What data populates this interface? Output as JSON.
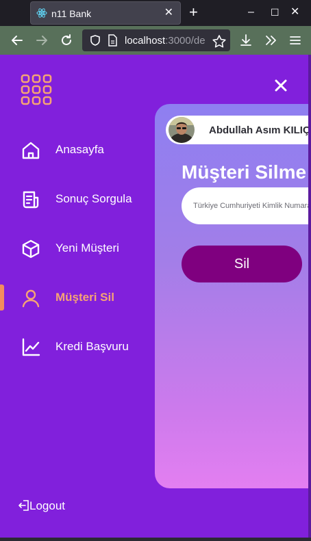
{
  "browser": {
    "tab_title": "n11 Bank",
    "tab_close": "✕",
    "new_tab": "+",
    "url_host": "localhost",
    "url_rest": ":3000/de",
    "window_controls": {
      "minimize": "–",
      "maximize": "☐",
      "close": "✕"
    },
    "icons": [
      "react-favicon",
      "back-arrow",
      "forward-arrow",
      "reload",
      "shield",
      "page",
      "star",
      "download",
      "chevron-double-right",
      "hamburger-menu"
    ]
  },
  "colors": {
    "app_bg": "#8120dc",
    "active_accent": "#f6a474",
    "button": "#7f007f",
    "card_gradient_top": "#8e7ff1",
    "card_gradient_bottom": "#e37ff1"
  },
  "sidebar": {
    "items": [
      {
        "label": "Anasayfa",
        "icon": "home-icon",
        "active": false
      },
      {
        "label": "Sonuç Sorgula",
        "icon": "document-icon",
        "active": false
      },
      {
        "label": "Yeni Müşteri",
        "icon": "cube-icon",
        "active": false
      },
      {
        "label": "Müşteri Sil",
        "icon": "user-icon",
        "active": true
      },
      {
        "label": "Kredi Başvuru",
        "icon": "chart-line-icon",
        "active": false
      }
    ],
    "logout_label": "Logout"
  },
  "user": {
    "name": "Abdullah Asım KILIÇ"
  },
  "form": {
    "title": "Müşteri Silme",
    "tc_placeholder": "Türkiye Cumhuriyeti Kimlik Numarası",
    "submit_label": "Sil"
  }
}
